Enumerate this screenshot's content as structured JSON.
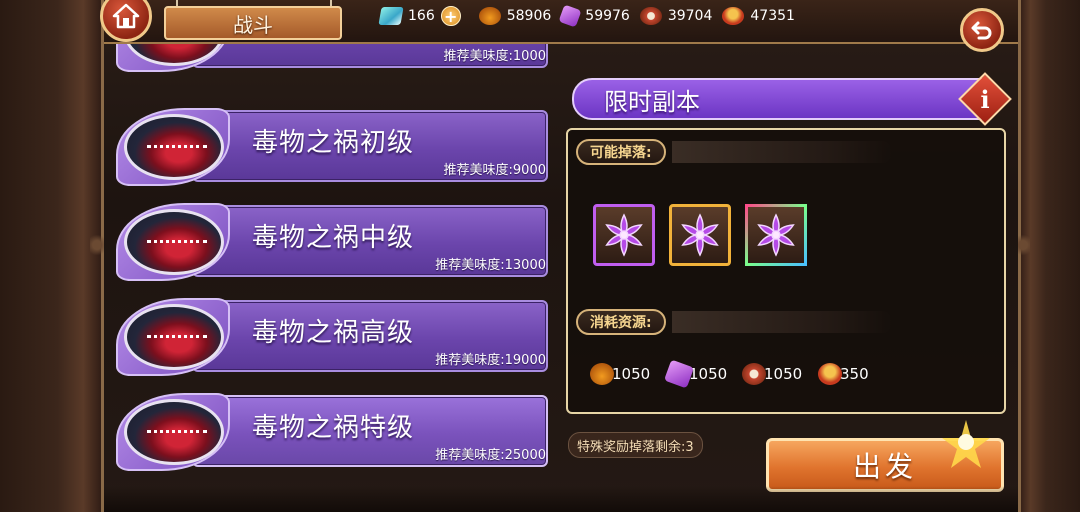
{
  "header": {
    "title": "战斗"
  },
  "resources": [
    {
      "icon": "gem-icon",
      "value": "166",
      "has_plus": true
    },
    {
      "icon": "potion-icon",
      "value": "58906"
    },
    {
      "icon": "crystal-icon",
      "value": "59976"
    },
    {
      "icon": "meat-icon",
      "value": "39704"
    },
    {
      "icon": "drum-icon",
      "value": "47351"
    }
  ],
  "dungeons": [
    {
      "name": "",
      "recommend": "推荐美味度:1000"
    },
    {
      "name": "毒物之祸初级",
      "recommend": "推荐美味度:9000"
    },
    {
      "name": "毒物之祸中级",
      "recommend": "推荐美味度:13000"
    },
    {
      "name": "毒物之祸高级",
      "recommend": "推荐美味度:19000"
    },
    {
      "name": "毒物之祸特级",
      "recommend": "推荐美味度:25000"
    }
  ],
  "detail": {
    "title": "限时副本",
    "info_icon": "i",
    "drops_label": "可能掉落:",
    "drops": [
      {
        "icon": "purple-flower-icon",
        "frame": "#c05ef0"
      },
      {
        "icon": "purple-flower-icon",
        "frame": "#f1b23a"
      },
      {
        "icon": "purple-flower-icon",
        "frame": "rainbow"
      }
    ],
    "cost_label": "消耗资源:",
    "costs": [
      {
        "icon": "potion-icon",
        "value": "1050"
      },
      {
        "icon": "crystal-icon",
        "value": "1050"
      },
      {
        "icon": "meat-icon",
        "value": "1050"
      },
      {
        "icon": "drum-icon",
        "value": "350"
      }
    ],
    "bonus_text": "特殊奖励掉落剩余:3",
    "go_label": "出发"
  },
  "colors": {
    "accent_purple": "#6b45ac",
    "go_orange": "#e0742e",
    "frame_gold": "#e7d5a6"
  }
}
